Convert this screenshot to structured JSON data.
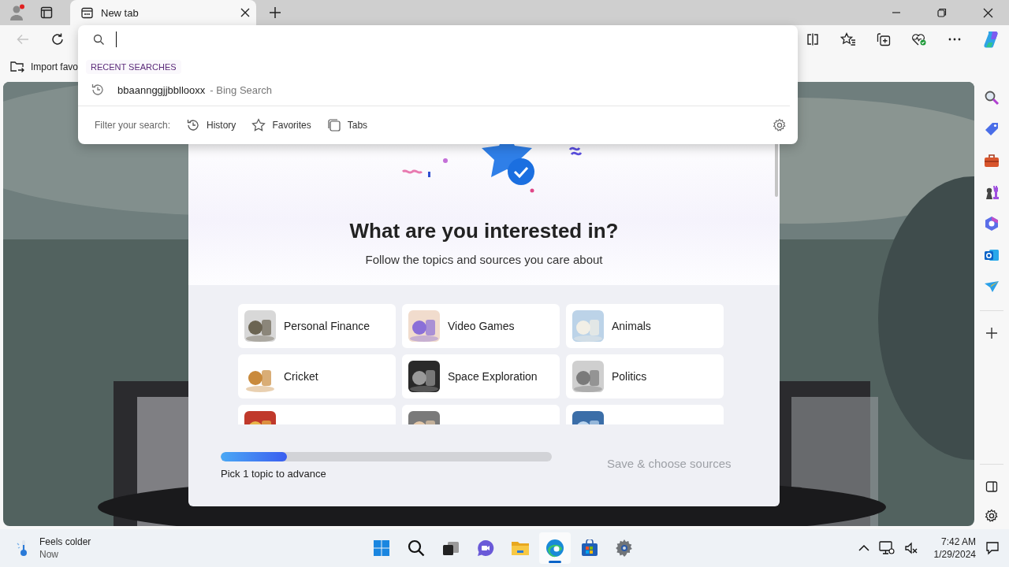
{
  "tabs": [
    {
      "title": "New tab",
      "selected": true
    }
  ],
  "address_dropdown": {
    "recent_heading": "RECENT SEARCHES",
    "recent": [
      {
        "query": "bbaannggjjbbllooxx",
        "source": "- Bing Search"
      }
    ],
    "filter_label": "Filter your search:",
    "filters": [
      {
        "kind": "history",
        "label": "History"
      },
      {
        "kind": "favorites",
        "label": "Favorites"
      },
      {
        "kind": "tabs",
        "label": "Tabs"
      }
    ]
  },
  "favorites_bar": {
    "import_label": "Import favo"
  },
  "interests": {
    "title": "What are you interested in?",
    "subtitle": "Follow the topics and sources you care about",
    "topics": [
      {
        "kind": "labeled",
        "label": "Personal Finance"
      },
      {
        "kind": "labeled",
        "label": "Video Games"
      },
      {
        "kind": "labeled",
        "label": "Animals"
      },
      {
        "kind": "labeled",
        "label": "Cricket"
      },
      {
        "kind": "labeled",
        "label": "Space Exploration"
      },
      {
        "kind": "labeled",
        "label": "Politics"
      },
      {
        "kind": "picture"
      },
      {
        "kind": "picture"
      },
      {
        "kind": "picture"
      }
    ],
    "progress": {
      "level": 0.2
    },
    "progress_text": "Pick 1 topic to advance",
    "save_button": {
      "label": "Save & choose sources",
      "disabled": true
    }
  },
  "taskbar": {
    "weather_title": "Feels colder",
    "weather_sub": "Now",
    "apps": [
      {
        "kind": "start",
        "selected": false
      },
      {
        "kind": "search",
        "selected": false
      },
      {
        "kind": "taskview",
        "selected": false
      },
      {
        "kind": "chat",
        "selected": false
      },
      {
        "kind": "explorer",
        "selected": false
      },
      {
        "kind": "edge",
        "selected": true
      },
      {
        "kind": "store",
        "selected": false
      },
      {
        "kind": "settings",
        "selected": false
      }
    ],
    "time": "7:42 AM",
    "date": "1/29/2024"
  }
}
